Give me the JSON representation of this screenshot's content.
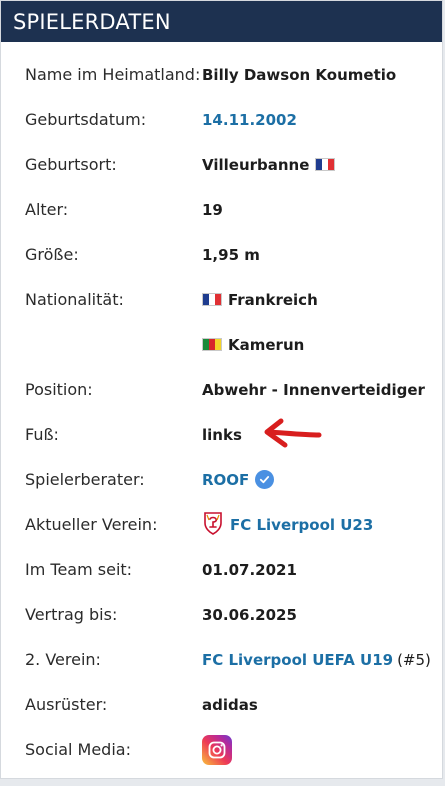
{
  "header": {
    "title": "SPIELERDATEN"
  },
  "rows": [
    {
      "label": "Name im Heimatland:",
      "value": "Billy Dawson Kouметio"
    },
    {
      "label": "Geburtsdatum:",
      "value": "14.11.2002"
    },
    {
      "label": "Geburtsort:",
      "value": "Villeurbanne"
    },
    {
      "label": "Alter:",
      "value": "19"
    },
    {
      "label": "Größe:",
      "value": "1,95 m"
    },
    {
      "label": "Nationalität:",
      "value": "Frankreich"
    },
    {
      "label": "",
      "value": "Kamerun"
    },
    {
      "label": "Position:",
      "value": "Abwehr - Innenverteidiger"
    },
    {
      "label": "Fuß:",
      "value": "links"
    },
    {
      "label": "Spielerberater:",
      "value": "ROOF"
    },
    {
      "label": "Aktueller Verein:",
      "value": "FC Liverpool U23"
    },
    {
      "label": "Im Team seit:",
      "value": "01.07.2021"
    },
    {
      "label": "Vertrag bis:",
      "value": "30.06.2025"
    },
    {
      "label": "2. Verein:",
      "value": "FC Liverpool UEFA U19",
      "extra": "(#5)"
    },
    {
      "label": "Ausrüster:",
      "value": "adidas"
    },
    {
      "label": "Social Media:",
      "value": ""
    }
  ],
  "colors": {
    "header_bg": "#1d3150",
    "link": "#1c6fa5",
    "annotation_arrow": "#d81e1e"
  },
  "icons": {
    "birthplace_flag": "france-flag-icon",
    "nationality_1_flag": "france-flag-icon",
    "nationality_2_flag": "cameroon-flag-icon",
    "agent_badge": "verified-check-icon",
    "club_logo": "liverpool-crest-icon",
    "social": "instagram-icon"
  }
}
